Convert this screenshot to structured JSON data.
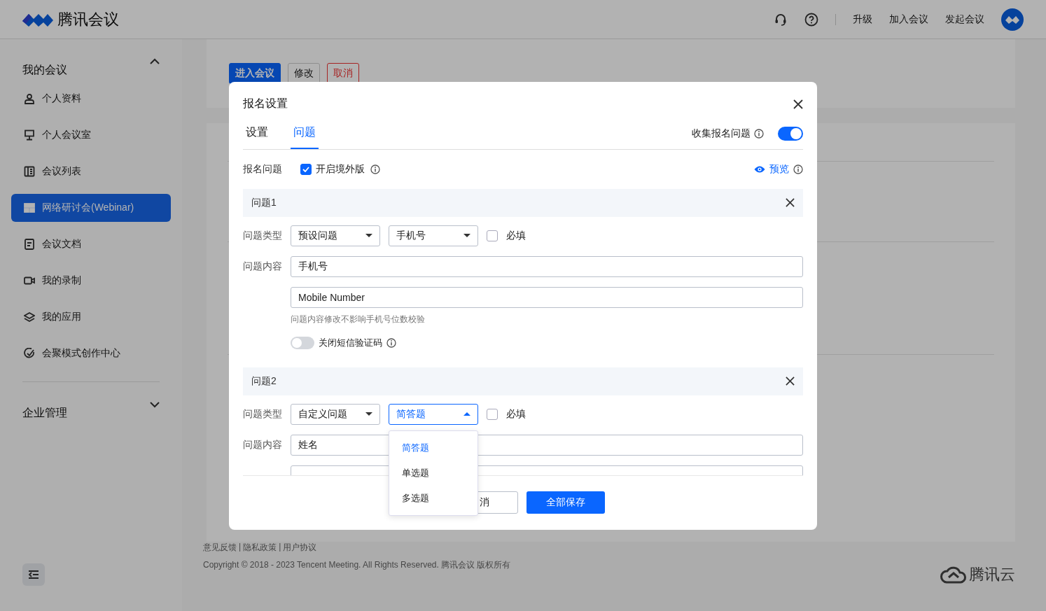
{
  "header": {
    "brand": "腾讯会议",
    "links": [
      "升级",
      "加入会议",
      "发起会议"
    ]
  },
  "sidebar": {
    "groups": [
      {
        "label": "我的会议",
        "expanded": true,
        "items": [
          {
            "label": "个人资料",
            "selected": false
          },
          {
            "label": "个人会议室",
            "selected": false
          },
          {
            "label": "会议列表",
            "selected": false
          },
          {
            "label": "网络研讨会(Webinar)",
            "selected": true
          },
          {
            "label": "会议文档",
            "selected": false
          },
          {
            "label": "我的录制",
            "selected": false
          },
          {
            "label": "我的应用",
            "selected": false
          },
          {
            "label": "会聚模式创作中心",
            "selected": false
          }
        ]
      },
      {
        "label": "企业管理",
        "expanded": false
      }
    ]
  },
  "meeting_card": {
    "buttons": [
      {
        "label": "进入会议",
        "kind": "primary"
      },
      {
        "label": "修改",
        "kind": "default"
      },
      {
        "label": "取消",
        "kind": "danger"
      }
    ]
  },
  "footer": {
    "links": [
      "意见反馈",
      "隐私政策",
      "用户协议"
    ],
    "separator": "|",
    "copyright": "Copyright © 2018 - 2023 Tencent Meeting. All Rights Reserved. 腾讯会议 版权所有",
    "brand": "腾讯云"
  },
  "modal": {
    "title": "报名设置",
    "tabs": [
      {
        "label": "设置",
        "selected": false
      },
      {
        "label": "问题",
        "selected": true
      }
    ],
    "collect": {
      "label": "收集报名问题",
      "on": true
    },
    "section_label": "报名问题",
    "overseas": {
      "label": "开启境外版",
      "checked": true
    },
    "preview": "预览",
    "questions": [
      {
        "title": "问题1",
        "type_label": "问题类型",
        "type": "预设问题",
        "subtype": "手机号",
        "subtype_open": false,
        "required": {
          "label": "必填",
          "checked": false
        },
        "content_label": "问题内容",
        "content": "手机号",
        "content_en": "Mobile Number",
        "hint": "问题内容修改不影响手机号位数校验",
        "sms": {
          "label": "关闭短信验证码",
          "on": false
        }
      },
      {
        "title": "问题2",
        "type_label": "问题类型",
        "type": "自定义问题",
        "subtype": "简答题",
        "subtype_open": true,
        "required": {
          "label": "必填",
          "checked": false
        },
        "content_label": "问题内容",
        "content": "姓名"
      }
    ],
    "dropdown": {
      "options": [
        {
          "label": "简答题",
          "selected": true
        },
        {
          "label": "单选题",
          "selected": false
        },
        {
          "label": "多选题",
          "selected": false
        }
      ]
    },
    "buttons": {
      "cancel": "消",
      "save": "全部保存"
    }
  }
}
